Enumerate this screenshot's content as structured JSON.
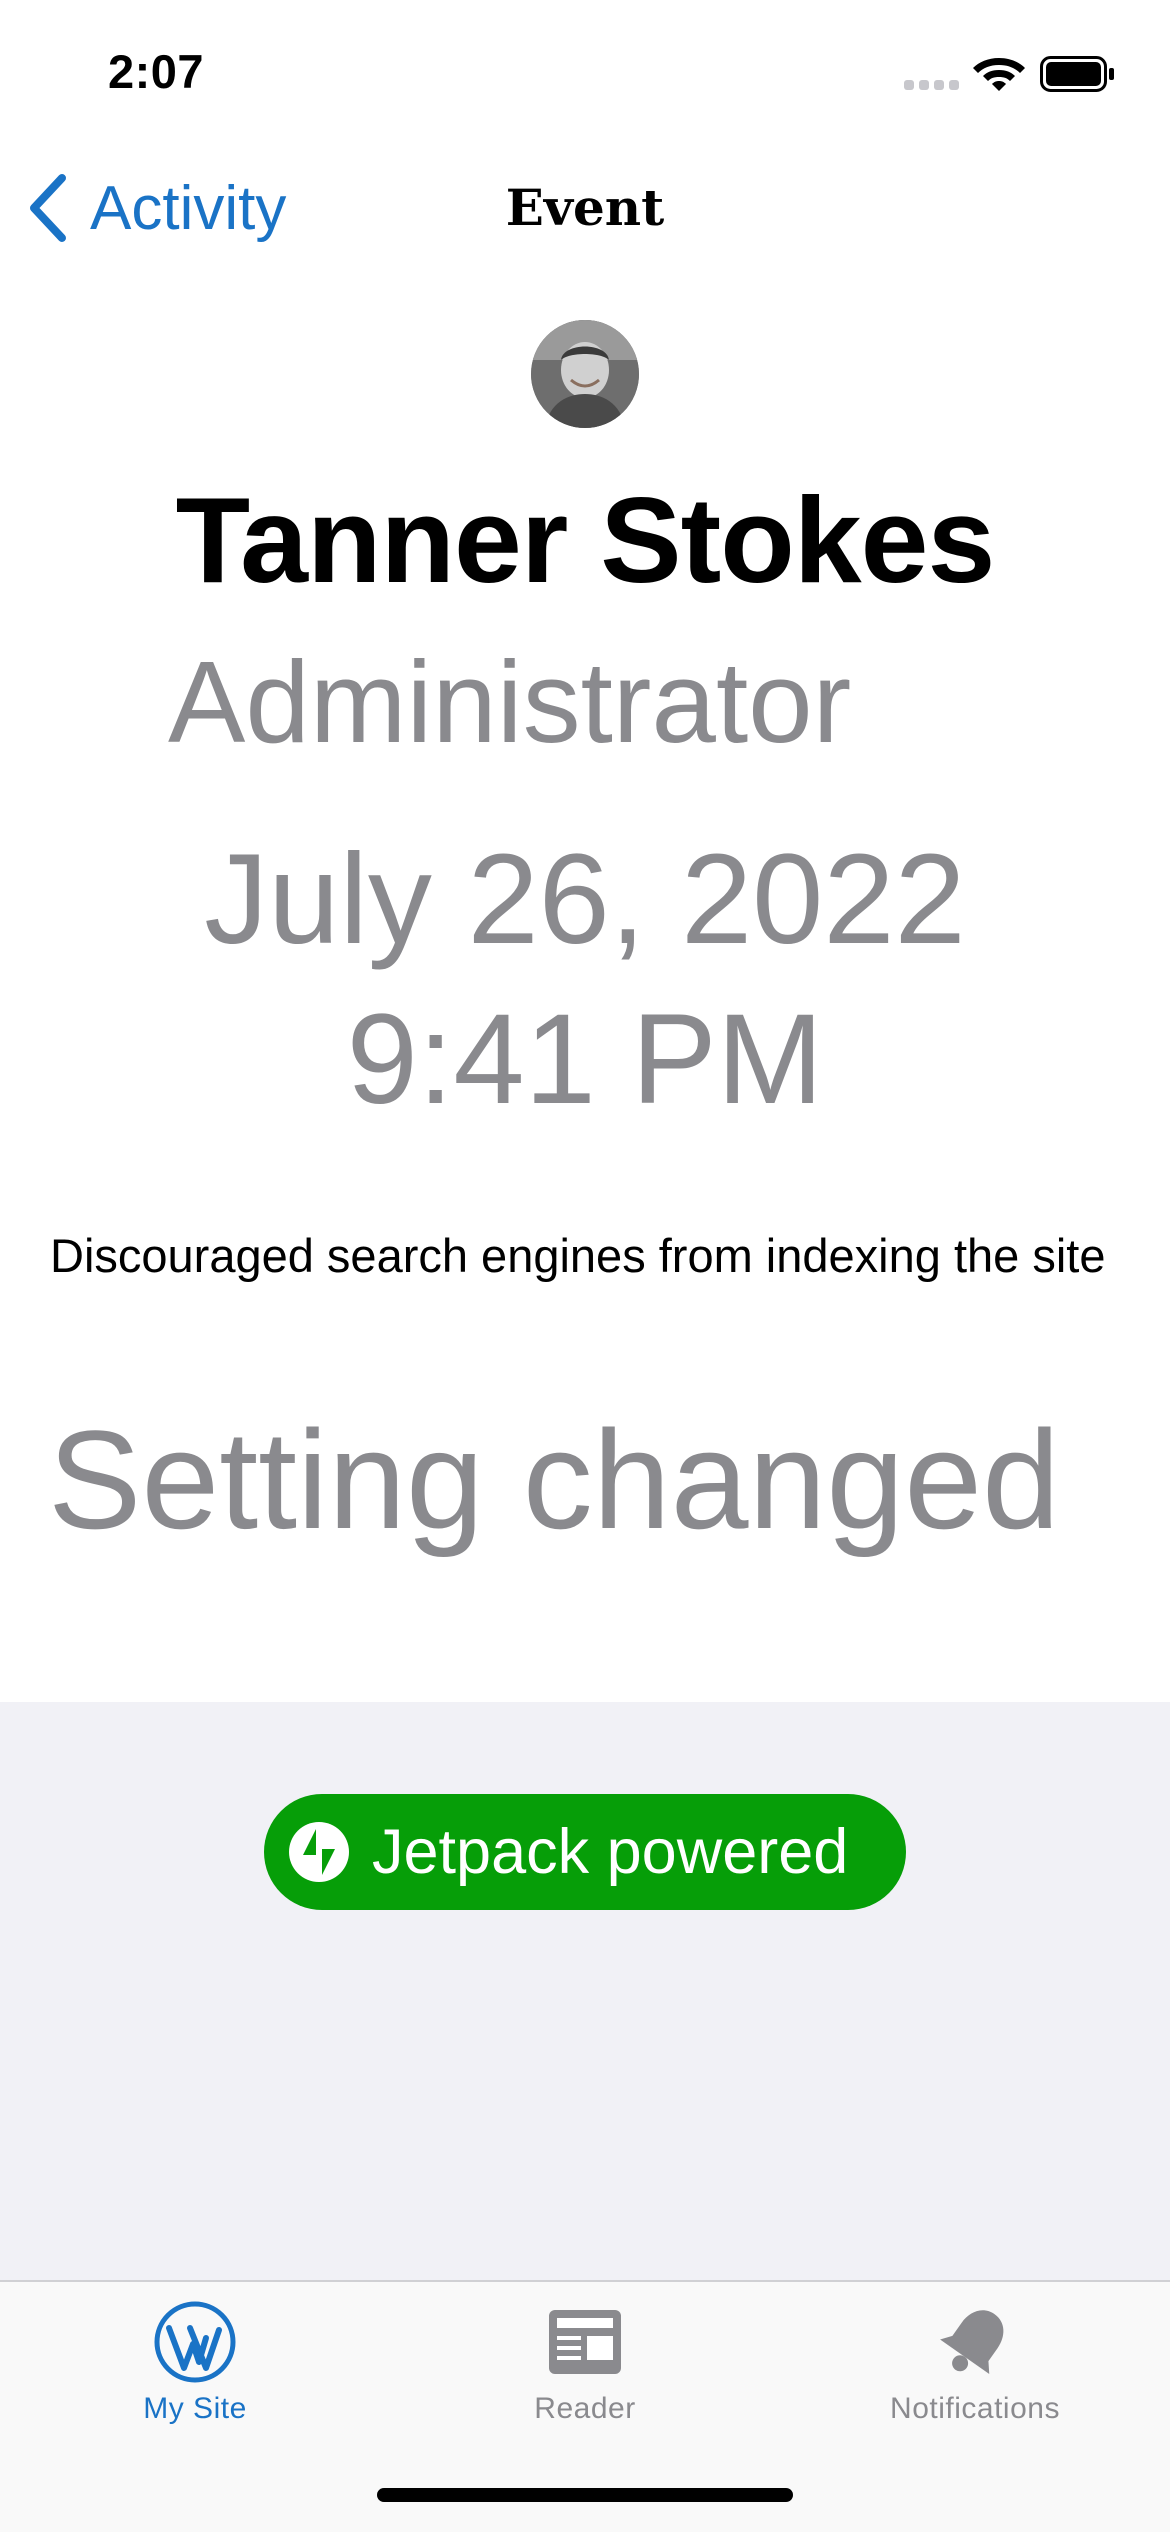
{
  "status_bar": {
    "time": "2:07"
  },
  "nav": {
    "back_label": "Activity",
    "title": "Event"
  },
  "event": {
    "actor_name": "Tanner Stokes",
    "actor_role": "Administrator",
    "date": "July 26, 2022",
    "time": "9:41 PM",
    "description": "Discouraged search engines from indexing the site",
    "type": "Setting changed"
  },
  "footer": {
    "badge_label": "Jetpack powered",
    "badge_color": "#069e08"
  },
  "tabs": [
    {
      "label": "My Site",
      "icon": "wordpress-icon",
      "selected": true
    },
    {
      "label": "Reader",
      "icon": "reader-icon",
      "selected": false
    },
    {
      "label": "Notifications",
      "icon": "bell-icon",
      "selected": false
    }
  ],
  "colors": {
    "accent": "#1a73c6",
    "secondary_text": "#8a8a8e",
    "footer_background": "#f1f1f6"
  }
}
